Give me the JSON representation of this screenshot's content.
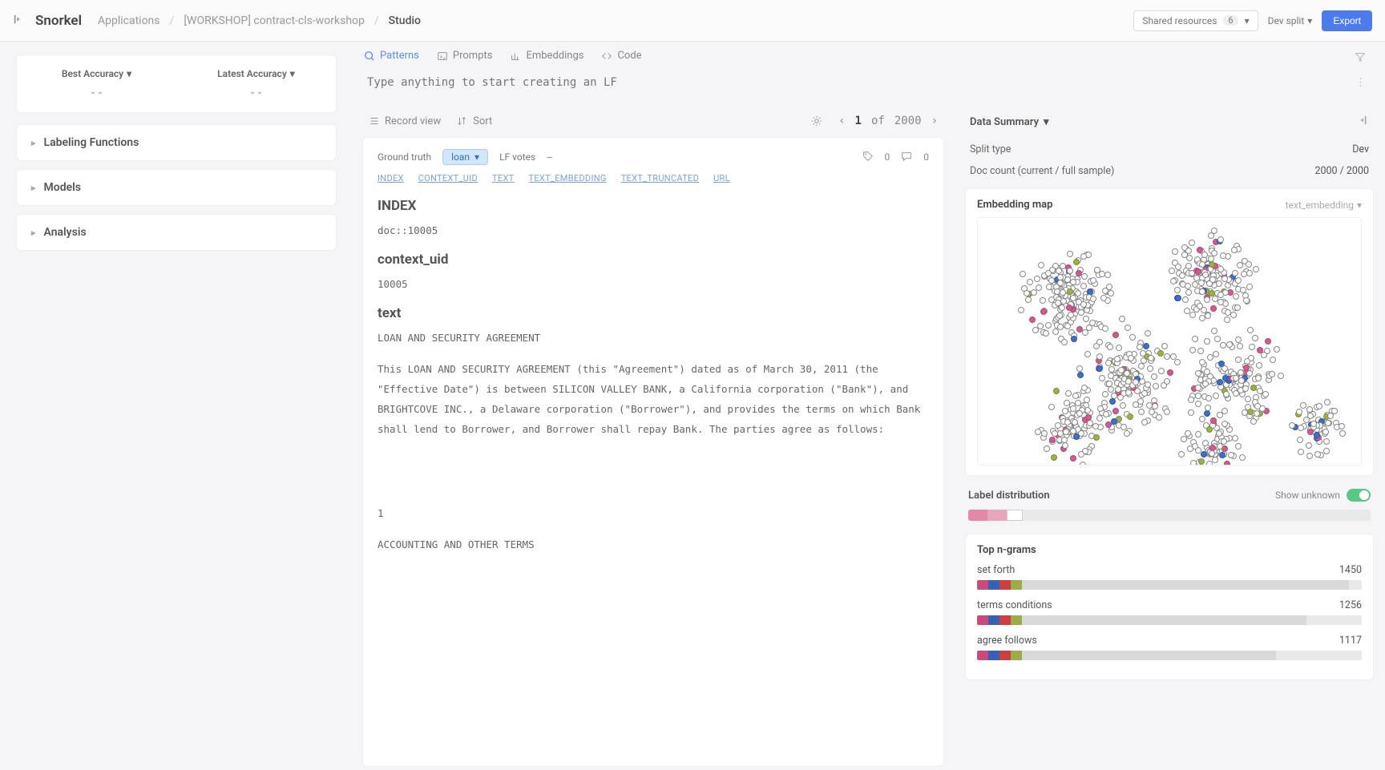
{
  "topbar": {
    "logo": "Snorkel",
    "breadcrumbs": [
      "Applications",
      "[WORKSHOP] contract-cls-workshop",
      "Studio"
    ],
    "shared_resources": "Shared resources",
    "shared_badge": "6",
    "dev_split": "Dev split",
    "export": "Export"
  },
  "sidebar": {
    "best_accuracy_label": "Best Accuracy",
    "best_accuracy_value": "--",
    "latest_accuracy_label": "Latest Accuracy",
    "latest_accuracy_value": "--",
    "sections": {
      "labeling_functions": "Labeling Functions",
      "models": "Models",
      "analysis": "Analysis"
    }
  },
  "tabs": {
    "patterns": "Patterns",
    "prompts": "Prompts",
    "embeddings": "Embeddings",
    "code": "Code"
  },
  "lf_input_placeholder": "Type anything to start creating an LF",
  "record_toolbar": {
    "record_view": "Record view",
    "sort": "Sort",
    "page_current": "1",
    "page_sep": "of",
    "page_total": "2000"
  },
  "record": {
    "ground_truth_label": "Ground truth",
    "ground_truth_value": "loan",
    "lf_votes_label": "LF votes",
    "lf_votes_value": "--",
    "tags_count": "0",
    "comments_count": "0",
    "field_links": [
      "INDEX",
      "CONTEXT_UID",
      "TEXT",
      "TEXT_EMBEDDING",
      "TEXT_TRUNCATED",
      "URL"
    ],
    "fields": {
      "index_heading": "INDEX",
      "index_value": "doc::10005",
      "context_uid_heading": "context_uid",
      "context_uid_value": "10005",
      "text_heading": "text",
      "text_value_1": "LOAN AND SECURITY AGREEMENT",
      "text_value_2": "This LOAN AND SECURITY AGREEMENT (this \"Agreement\") dated as of March 30, 2011 (the \"Effective Date\") is between SILICON VALLEY BANK, a California corporation (\"Bank\"), and BRIGHTCOVE INC., a Delaware corporation (\"Borrower\"), and provides the terms on which Bank shall lend to Borrower, and Borrower shall repay Bank. The parties agree as follows:",
      "text_value_3": "1",
      "text_value_4": "ACCOUNTING AND OTHER TERMS"
    }
  },
  "data_summary": {
    "title": "Data Summary",
    "split_type_label": "Split type",
    "split_type_value": "Dev",
    "doc_count_label": "Doc count (current / full sample)",
    "doc_count_value": "2000 / 2000"
  },
  "embedding_map": {
    "title": "Embedding map",
    "source": "text_embedding"
  },
  "label_distribution": {
    "title": "Label distribution",
    "show_unknown": "Show unknown"
  },
  "ngrams": {
    "title": "Top n-grams",
    "rows": [
      {
        "term": "set forth",
        "count": "1450",
        "fill": 85
      },
      {
        "term": "terms conditions",
        "count": "1256",
        "fill": 74
      },
      {
        "term": "agree follows",
        "count": "1117",
        "fill": 66
      }
    ]
  },
  "chart_data": {
    "type": "scatter",
    "title": "Embedding map",
    "note": "2D embedding projection; points positioned qualitatively, not on labeled axes.",
    "series": [
      {
        "name": "unlabeled",
        "color": "#ffffff",
        "approx_count": 900
      },
      {
        "name": "pink",
        "color": "#d15b8f",
        "approx_count": 70
      },
      {
        "name": "blue",
        "color": "#3b6fc9",
        "approx_count": 40
      },
      {
        "name": "olive",
        "color": "#9eae4a",
        "approx_count": 25
      }
    ]
  }
}
